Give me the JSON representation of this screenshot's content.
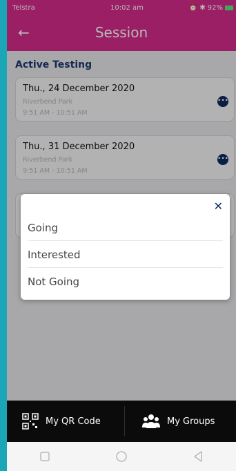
{
  "statusbar": {
    "carrier": "Telstra",
    "time": "10:02 am",
    "battery": "92%"
  },
  "appbar": {
    "title": "Session",
    "back_icon": "arrow-left-icon"
  },
  "section": {
    "title": "Active Testing"
  },
  "sessions": [
    {
      "date": "Thu., 24 December 2020",
      "location": "Riverbend Park",
      "time": "9:51 AM  -  10:51 AM"
    },
    {
      "date": "Thu., 31 December 2020",
      "location": "Riverbend Park",
      "time": "9:51 AM  -  10:51 AM"
    }
  ],
  "modal": {
    "options": [
      "Going",
      "Interested",
      "Not Going"
    ],
    "close_icon": "close-icon"
  },
  "bottomnav": {
    "qr_label": "My QR Code",
    "groups_label": "My Groups"
  },
  "colors": {
    "appbar": "#d72c8c",
    "heading": "#1e3a72",
    "accent_dark": "#0e2a5e",
    "background": "#1aa6b6"
  }
}
